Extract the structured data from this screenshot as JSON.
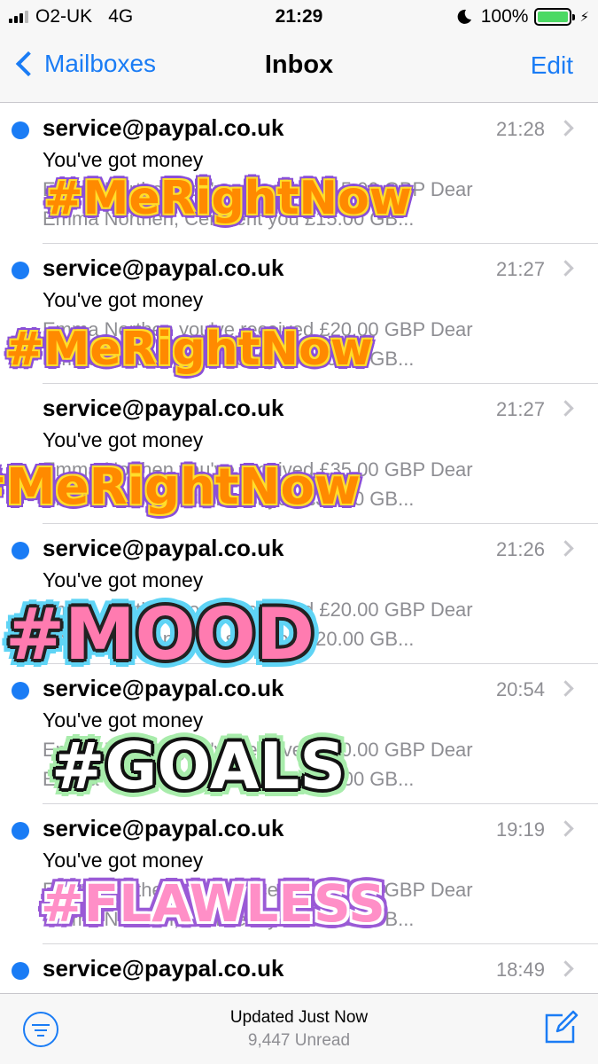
{
  "status_bar": {
    "carrier": "O2-UK",
    "network": "4G",
    "time": "21:29",
    "battery": "100%",
    "icons": [
      "signal-icon",
      "moon-icon",
      "battery-icon",
      "charging-icon"
    ]
  },
  "nav": {
    "back_label": "Mailboxes",
    "title": "Inbox",
    "edit_label": "Edit"
  },
  "messages": [
    {
      "unread": true,
      "sender": "service@paypal.co.uk",
      "time": "21:28",
      "subject": "You've got money",
      "preview_1": "Emma Northen you've received £15.00 GBP Dear",
      "preview_2": "Emma Northen, Ceri sent you £15.00 GB..."
    },
    {
      "unread": true,
      "sender": "service@paypal.co.uk",
      "time": "21:27",
      "subject": "You've got money",
      "preview_1": "Emma Northen you've received £20.00 GBP Dear",
      "preview_2": "Emma Northen, Ceri sent you £20.00 GB..."
    },
    {
      "unread": false,
      "sender": "service@paypal.co.uk",
      "time": "21:27",
      "subject": "You've got money",
      "preview_1": "Emma Northen you've received £35.00 GBP Dear",
      "preview_2": "Emma Northen, Ceri sent you £35.00 GB..."
    },
    {
      "unread": true,
      "sender": "service@paypal.co.uk",
      "time": "21:26",
      "subject": "You've got money",
      "preview_1": "Emma Northen you've received £20.00 GBP Dear",
      "preview_2": "Emma Northen, Ceri sent you £20.00 GB..."
    },
    {
      "unread": true,
      "sender": "service@paypal.co.uk",
      "time": "20:54",
      "subject": "You've got money",
      "preview_1": "Emma Northen you've received £20.00 GBP Dear",
      "preview_2": "Emma Northen, Ceri sent you £20.00 GB..."
    },
    {
      "unread": true,
      "sender": "service@paypal.co.uk",
      "time": "19:19",
      "subject": "You've got money",
      "preview_1": "Emma Northen you've received £35.00 GBP Dear",
      "preview_2": "Emma Northen, Ceri sent you £35.00 GB..."
    },
    {
      "unread": true,
      "sender": "service@paypal.co.uk",
      "time": "18:49",
      "subject": "",
      "preview_1": "",
      "preview_2": ""
    }
  ],
  "stickers": [
    "#MeRightNow",
    "#MeRightNow",
    "#MeRightNow",
    "#MOOD",
    "#GOALS",
    "#FLAWLESS"
  ],
  "toolbar": {
    "updated": "Updated Just Now",
    "unread_count": "9,447 Unread"
  },
  "colors": {
    "accent": "#1a7cf5",
    "battery_fill": "#4cd964",
    "secondary_text": "#8e8e93"
  }
}
